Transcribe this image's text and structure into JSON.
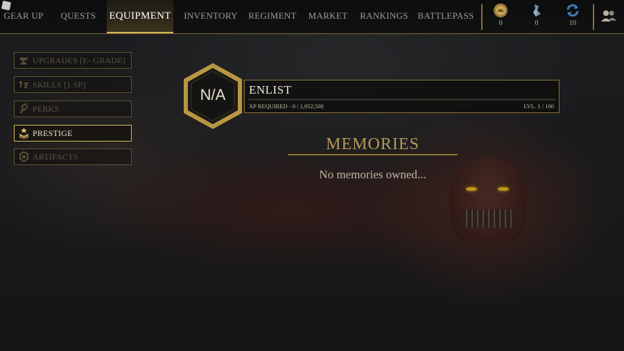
{
  "nav": {
    "tabs": [
      {
        "label": "GEAR UP"
      },
      {
        "label": "QUESTS"
      },
      {
        "label": "EQUIPMENT",
        "active": true
      },
      {
        "label": "INVENTORY"
      },
      {
        "label": "REGIMENT"
      },
      {
        "label": "MARKET"
      },
      {
        "label": "RANKINGS"
      },
      {
        "label": "BATTLEPASS"
      }
    ]
  },
  "currencies": [
    {
      "icon": "gold-coin-icon",
      "value": "0"
    },
    {
      "icon": "crystal-icon",
      "value": "0"
    },
    {
      "icon": "spin-refresh-icon",
      "value": "10"
    }
  ],
  "side_menu": {
    "items": [
      {
        "icon": "anvil-icon",
        "label": "UPGRADES [E- GRADE]"
      },
      {
        "icon": "skill-arrows-icon",
        "label": "SKILLS [1 SP]"
      },
      {
        "icon": "dna-icon",
        "label": "PERKS"
      },
      {
        "icon": "prestige-stack-icon",
        "label": "PRESTIGE",
        "active": true
      },
      {
        "icon": "artifact-icon",
        "label": "ARTIFACTS"
      }
    ]
  },
  "enlist": {
    "badge": "N/A",
    "title": "ENLIST",
    "xp_text": "XP REQUIRED - 0 / 1,952,500",
    "level_text": "LVL. 1 / 100",
    "progress": 0
  },
  "memories": {
    "title": "MEMORIES",
    "empty_text": "No memories owned..."
  },
  "colors": {
    "accent_gold": "#d8b85c",
    "border_gold": "#8a7536",
    "background": "#191a1c"
  }
}
